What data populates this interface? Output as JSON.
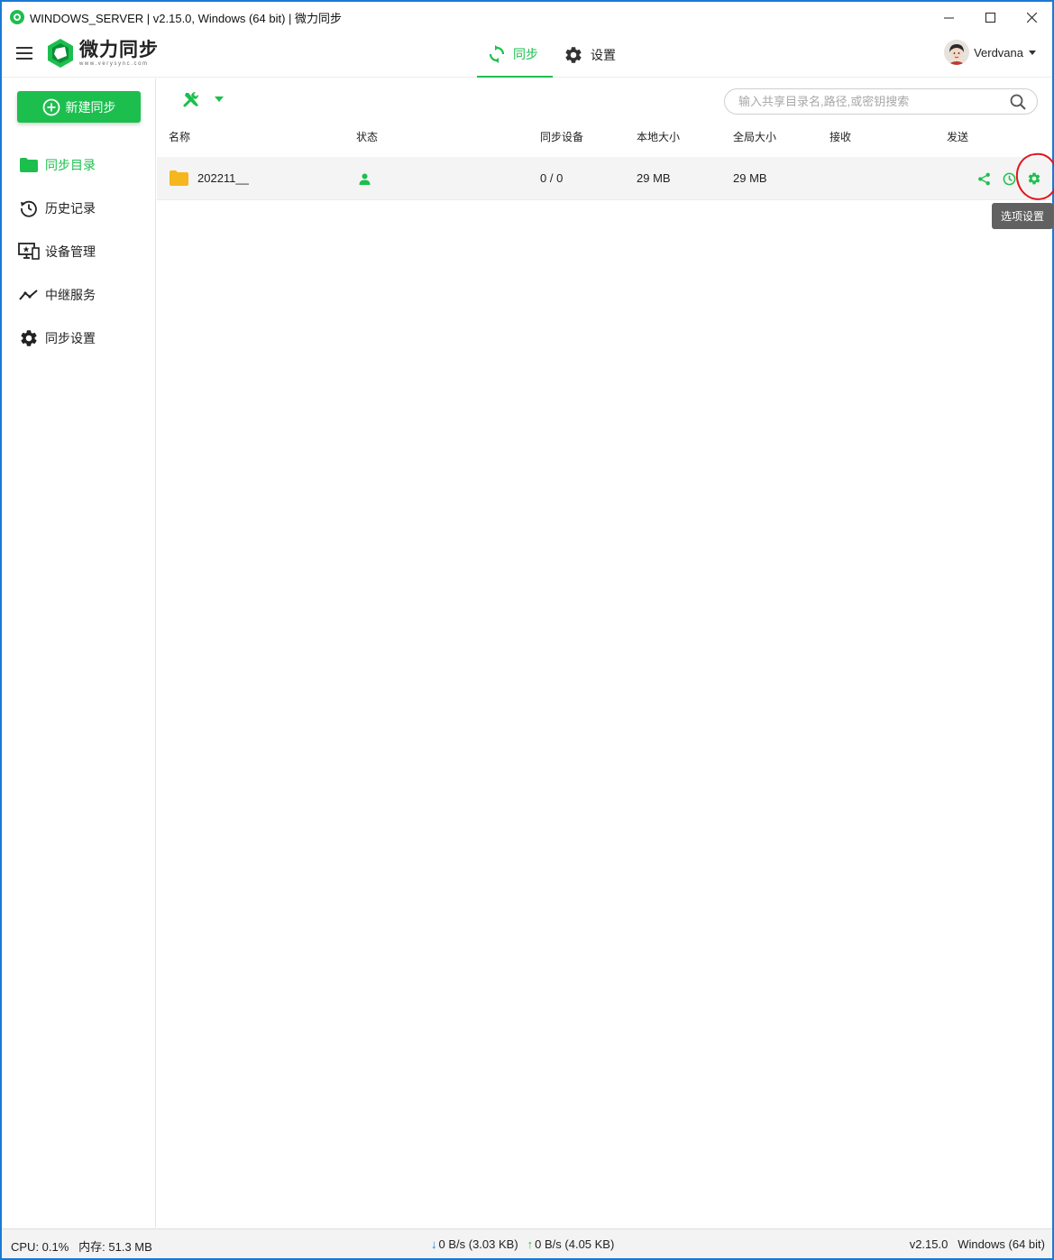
{
  "window": {
    "title": "WINDOWS_SERVER | v2.15.0, Windows (64 bit) | 微力同步"
  },
  "header": {
    "logo_text": "微力同步",
    "logo_url": "www.verysync.com",
    "tabs": [
      {
        "label": "同步",
        "icon": "sync-icon",
        "active": true
      },
      {
        "label": "设置",
        "icon": "gear-icon",
        "active": false
      }
    ],
    "user_name": "Verdvana"
  },
  "sidebar": {
    "new_button": "新建同步",
    "items": [
      {
        "label": "同步目录",
        "icon": "folder-icon",
        "active": true
      },
      {
        "label": "历史记录",
        "icon": "history-icon",
        "active": false
      },
      {
        "label": "设备管理",
        "icon": "device-icon",
        "active": false
      },
      {
        "label": "中继服务",
        "icon": "relay-icon",
        "active": false
      },
      {
        "label": "同步设置",
        "icon": "gear-icon",
        "active": false
      }
    ]
  },
  "main": {
    "search_placeholder": "输入共享目录名,路径,或密钥搜索",
    "columns": [
      "名称",
      "状态",
      "同步设备",
      "本地大小",
      "全局大小",
      "接收",
      "发送"
    ],
    "rows": [
      {
        "name": "202211__",
        "status_icon": "person-icon",
        "devices": "0 / 0",
        "local_size": "29 MB",
        "global_size": "29 MB",
        "receive": "",
        "send": ""
      }
    ],
    "tooltip": "选项设置"
  },
  "statusbar": {
    "cpu": "CPU: 0.1%",
    "memory": "内存: 51.3 MB",
    "download": "0 B/s (3.03 KB)",
    "upload": "0 B/s (4.05 KB)",
    "version": "v2.15.0",
    "platform": "Windows (64 bit)"
  },
  "colors": {
    "accent": "#1cbf4e",
    "window_border": "#1a7ad4",
    "annotation": "#e2161c",
    "folder": "#f6b61e"
  }
}
